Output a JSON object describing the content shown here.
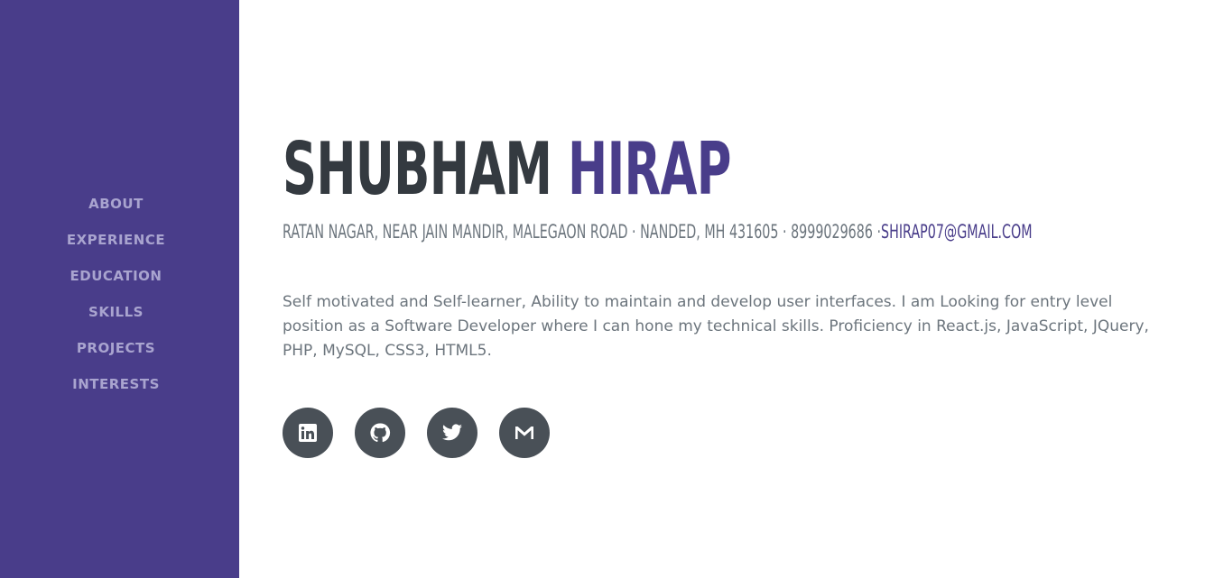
{
  "nav": {
    "items": [
      {
        "label": "About"
      },
      {
        "label": "Experience"
      },
      {
        "label": "Education"
      },
      {
        "label": "Skills"
      },
      {
        "label": "Projects"
      },
      {
        "label": "Interests"
      }
    ]
  },
  "header": {
    "first_name": "SHUBHAM",
    "last_name": "HIRAP"
  },
  "contact": {
    "address": "Ratan Nagar, Near Jain Mandir, Malegaon Road · Nanded, MH 431605 · 8999029686 ·",
    "email": "shirap07@gmail.com"
  },
  "about": {
    "bio": "Self motivated and Self-learner, Ability to maintain and develop user interfaces. I am Looking for entry level position as a Software Developer where I can hone my technical skills. Proficiency in React.js, JavaScript, JQuery, PHP, MySQL, CSS3, HTML5."
  },
  "social": {
    "icons": [
      "linkedin-icon",
      "github-icon",
      "twitter-icon",
      "gmail-icon"
    ]
  },
  "colors": {
    "sidebar": "#493d8a",
    "accent": "#493d8a",
    "heading": "#343a40",
    "muted": "#6c757d",
    "social_bg": "#495057"
  }
}
